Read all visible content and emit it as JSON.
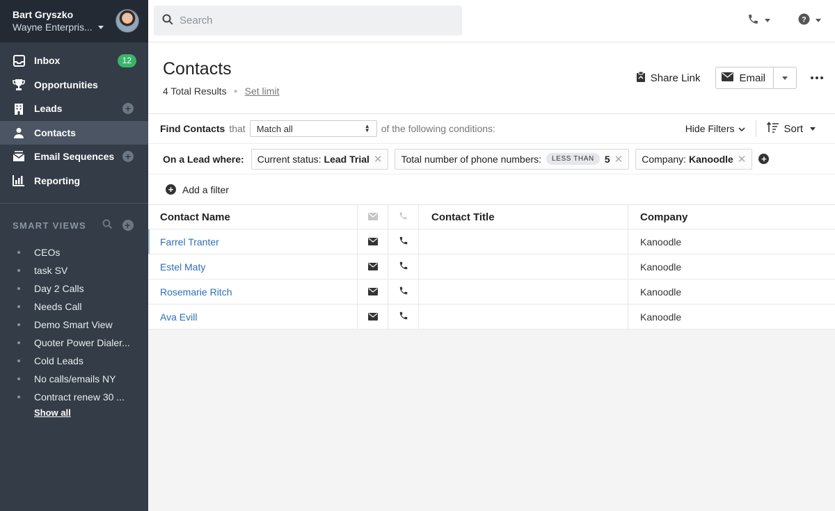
{
  "account": {
    "user_name": "Bart Gryszko",
    "org_name": "Wayne Enterpris..."
  },
  "nav": {
    "items": [
      {
        "label": "Inbox",
        "icon": "inbox-icon",
        "badge": "12"
      },
      {
        "label": "Opportunities",
        "icon": "trophy-icon"
      },
      {
        "label": "Leads",
        "icon": "building-icon"
      },
      {
        "label": "Contacts",
        "icon": "person-icon",
        "active": true
      },
      {
        "label": "Email Sequences",
        "icon": "envelope-stack-icon"
      },
      {
        "label": "Reporting",
        "icon": "bar-chart-icon"
      }
    ]
  },
  "smart_views": {
    "heading": "SMART VIEWS",
    "items": [
      "CEOs",
      "task SV",
      "Day 2 Calls",
      "Needs Call",
      "Demo Smart View",
      "Quoter Power Dialer...",
      "Cold Leads",
      "No calls/emails NY",
      "Contract renew 30 ..."
    ],
    "show_all": "Show all"
  },
  "search": {
    "placeholder": "Search"
  },
  "header": {
    "title": "Contacts",
    "total": "4 Total Results",
    "set_limit": "Set limit",
    "share_link": "Share Link",
    "email": "Email"
  },
  "filters": {
    "find_label": "Find Contacts",
    "that": "that",
    "match_value": "Match all",
    "conditions_text": "of the following conditions:",
    "hide_filters": "Hide Filters",
    "sort": "Sort",
    "lead_where": "On a Lead where:",
    "chips": [
      {
        "prefix": "Current status:",
        "value": "Lead Trial"
      },
      {
        "prefix": "Total number of phone numbers:",
        "operator": "LESS THAN",
        "value": "5"
      },
      {
        "prefix": "Company:",
        "value": "Kanoodle"
      }
    ],
    "add_filter": "Add a filter"
  },
  "table": {
    "headers": {
      "name": "Contact Name",
      "title": "Contact Title",
      "company": "Company"
    },
    "rows": [
      {
        "name": "Farrel Tranter",
        "title": "",
        "company": "Kanoodle"
      },
      {
        "name": "Estel Maty",
        "title": "",
        "company": "Kanoodle"
      },
      {
        "name": "Rosemarie Ritch",
        "title": "",
        "company": "Kanoodle"
      },
      {
        "name": "Ava Evill",
        "title": "",
        "company": "Kanoodle"
      }
    ]
  },
  "colors": {
    "sidebar_bg": "#333c47",
    "sidebar_top_bg": "#232a33",
    "active_nav_bg": "#4b5563",
    "badge_green": "#39b56a",
    "link_blue": "#2b6fb6"
  }
}
